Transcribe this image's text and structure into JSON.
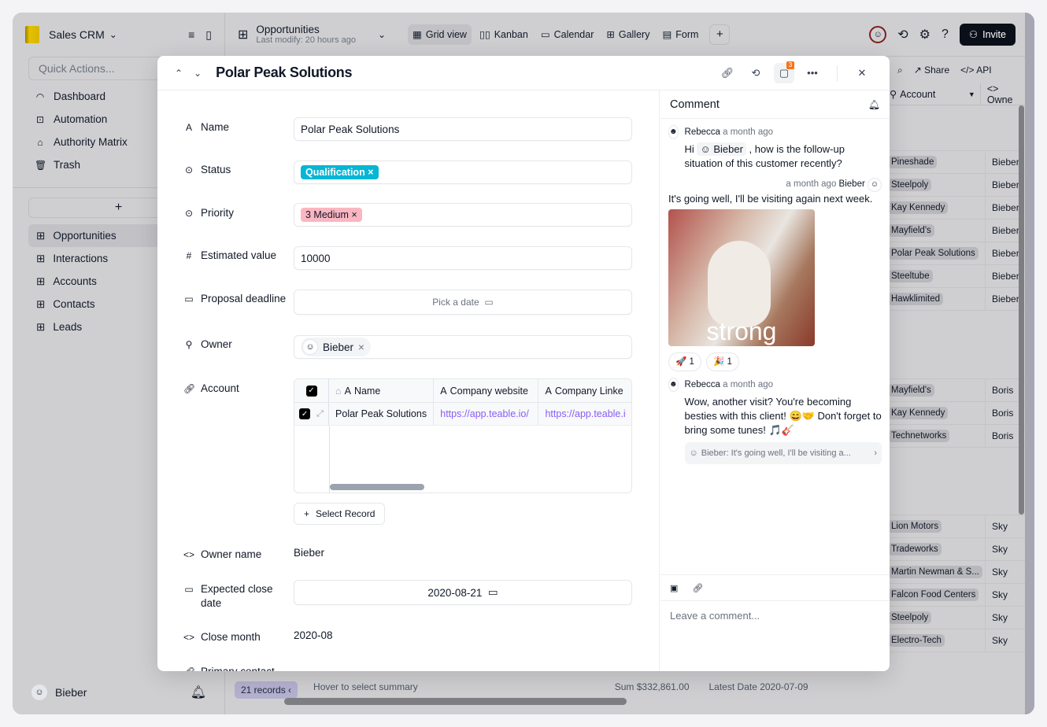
{
  "app": {
    "base_name": "Sales CRM",
    "quick_actions_placeholder": "Quick Actions...",
    "nav_items": [
      {
        "label": "Dashboard",
        "icon": "dashboard-icon"
      },
      {
        "label": "Automation",
        "icon": "robot-icon"
      },
      {
        "label": "Authority Matrix",
        "icon": "lock-icon"
      },
      {
        "label": "Trash",
        "icon": "trash-icon"
      }
    ],
    "add_label": "+",
    "tables": [
      {
        "label": "Opportunities",
        "active": true
      },
      {
        "label": "Interactions"
      },
      {
        "label": "Accounts"
      },
      {
        "label": "Contacts"
      },
      {
        "label": "Leads"
      }
    ],
    "user_name": "Bieber"
  },
  "topbar": {
    "table_name": "Opportunities",
    "last_modify": "Last modify: 20 hours ago",
    "views": [
      "Grid view",
      "Kanban",
      "Calendar",
      "Gallery",
      "Form"
    ],
    "active_view": "Grid view",
    "invite_label": "Invite",
    "share_label": "Share",
    "api_label": "API"
  },
  "grid": {
    "columns": [
      "Account",
      "Owne"
    ],
    "group1": [
      {
        "account": "Pineshade",
        "owner": "Bieber"
      },
      {
        "account": "Steelpoly",
        "owner": "Bieber"
      },
      {
        "account": "Kay Kennedy",
        "owner": "Bieber"
      },
      {
        "account": "Mayfield's",
        "owner": "Bieber"
      },
      {
        "account": "Polar Peak Solutions",
        "owner": "Bieber"
      },
      {
        "account": "Steeltube",
        "owner": "Bieber"
      },
      {
        "account": "Hawklimited",
        "owner": "Bieber"
      }
    ],
    "group2": [
      {
        "account": "Mayfield's",
        "owner": "Boris"
      },
      {
        "account": "Kay Kennedy",
        "owner": "Boris"
      },
      {
        "account": "Technetworks",
        "owner": "Boris"
      }
    ],
    "group3": [
      {
        "account": "Lion Motors",
        "owner": "Sky"
      },
      {
        "account": "Tradeworks",
        "owner": "Sky"
      },
      {
        "account": "Martin Newman & S...",
        "owner": "Sky"
      },
      {
        "account": "Falcon Food Centers",
        "owner": "Sky"
      },
      {
        "account": "Steelpoly",
        "owner": "Sky"
      },
      {
        "account": "Electro-Tech",
        "owner": "Sky"
      }
    ]
  },
  "footer": {
    "records": "21 records",
    "hover_hint": "Hover to select summary",
    "sum": "Sum $332,861.00",
    "latest_date": "Latest Date 2020-07-09"
  },
  "record": {
    "title": "Polar Peak Solutions",
    "comment_count": "3",
    "fields": {
      "name": {
        "label": "Name",
        "value": "Polar Peak Solutions"
      },
      "status": {
        "label": "Status",
        "value": "Qualification",
        "color": "#06b6d4"
      },
      "priority": {
        "label": "Priority",
        "value": "3 Medium",
        "color": "#fbb6c1"
      },
      "estimated_value": {
        "label": "Estimated value",
        "value": "10000"
      },
      "proposal_deadline": {
        "label": "Proposal deadline",
        "placeholder": "Pick a date"
      },
      "owner": {
        "label": "Owner",
        "value": "Bieber"
      },
      "account": {
        "label": "Account"
      },
      "owner_name": {
        "label": "Owner name",
        "value": "Bieber"
      },
      "expected_close": {
        "label": "Expected close date",
        "value": "2020-08-21"
      },
      "close_month": {
        "label": "Close month",
        "value": "2020-08"
      },
      "primary_contact": {
        "label": "Primary contact"
      }
    },
    "account_table": {
      "headers": [
        "Name",
        "Company website",
        "Company Linke"
      ],
      "rows": [
        {
          "name": "Polar Peak Solutions",
          "website": "https://app.teable.io/",
          "linkedin": "https://app.teable.i"
        }
      ]
    },
    "select_record_label": "Select Record"
  },
  "comments": {
    "title": "Comment",
    "items": [
      {
        "author": "Rebecca",
        "time": "a month ago",
        "text_pre": "Hi",
        "mention": "Bieber",
        "text_post": ", how is the follow-up situation of this customer recently?"
      },
      {
        "author": "Bieber",
        "time": "a month ago",
        "text": "It's going well, I'll be visiting again next week.",
        "gif_caption": "strong",
        "reactions": [
          {
            "emoji": "🚀",
            "count": "1"
          },
          {
            "emoji": "🎉",
            "count": "1"
          }
        ]
      },
      {
        "author": "Rebecca",
        "time": "a month ago",
        "text": "Wow, another visit? You're becoming besties with this client! 😄🤝 Don't forget to bring some tunes! 🎵🎸",
        "quote": "Bieber: It's going well, I'll be visiting a..."
      }
    ],
    "input_placeholder": "Leave a comment..."
  }
}
